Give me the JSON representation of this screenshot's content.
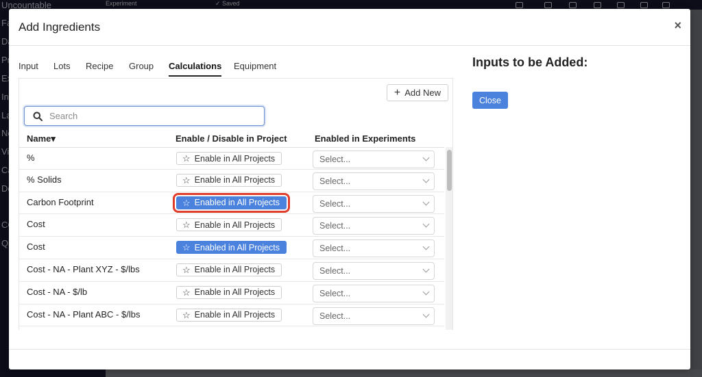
{
  "background": {
    "sidebar_items": [
      "Uncountable",
      "Fa",
      "Da",
      "Pr",
      "Ex",
      "In",
      "La",
      "No",
      "Vi",
      "Ca",
      "De",
      "CC",
      "Qu"
    ],
    "topbar": {
      "experiment_label": "Experiment",
      "saved_label": "✓ Saved"
    }
  },
  "modal": {
    "title": "Add Ingredients",
    "close_symbol": "×"
  },
  "tabs": [
    {
      "label": "Input",
      "active": false
    },
    {
      "label": "Lots",
      "active": false
    },
    {
      "label": "Recipe",
      "active": false
    },
    {
      "label": "Group",
      "active": false
    },
    {
      "label": "Calculations",
      "active": true
    },
    {
      "label": "Equipment",
      "active": false
    }
  ],
  "toolbar": {
    "add_new_label": "Add New",
    "add_new_icon": "plus-icon"
  },
  "search": {
    "placeholder": "Search",
    "value": ""
  },
  "table": {
    "headers": {
      "name": "Name",
      "sort_indicator": "▾",
      "enable": "Enable / Disable in Project",
      "experiments": "Enabled in Experiments"
    },
    "rows": [
      {
        "name": "%",
        "toggle": "Enable in All Projects",
        "enabled": false,
        "select": "Select..."
      },
      {
        "name": "% Solids",
        "toggle": "Enable in All Projects",
        "enabled": false,
        "select": "Select..."
      },
      {
        "name": "Carbon Footprint",
        "toggle": "Enabled in All Projects",
        "enabled": true,
        "select": "Select..."
      },
      {
        "name": "Cost",
        "toggle": "Enable in All Projects",
        "enabled": false,
        "select": "Select..."
      },
      {
        "name": "Cost",
        "toggle": "Enabled in All Projects",
        "enabled": true,
        "select": "Select..."
      },
      {
        "name": "Cost - NA - Plant XYZ - $/lbs",
        "toggle": "Enable in All Projects",
        "enabled": false,
        "select": "Select..."
      },
      {
        "name": "Cost - NA - $/lb",
        "toggle": "Enable in All Projects",
        "enabled": false,
        "select": "Select..."
      },
      {
        "name": "Cost - NA - Plant ABC - $/lbs",
        "toggle": "Enable in All Projects",
        "enabled": false,
        "select": "Select..."
      },
      {
        "name": "",
        "toggle": "",
        "enabled": false,
        "select": ""
      }
    ]
  },
  "right_panel": {
    "title": "Inputs to be Added:",
    "close_label": "Close"
  },
  "colors": {
    "accent": "#4a82de",
    "highlight": "#e03c2c",
    "sidebar": "#15172c"
  }
}
